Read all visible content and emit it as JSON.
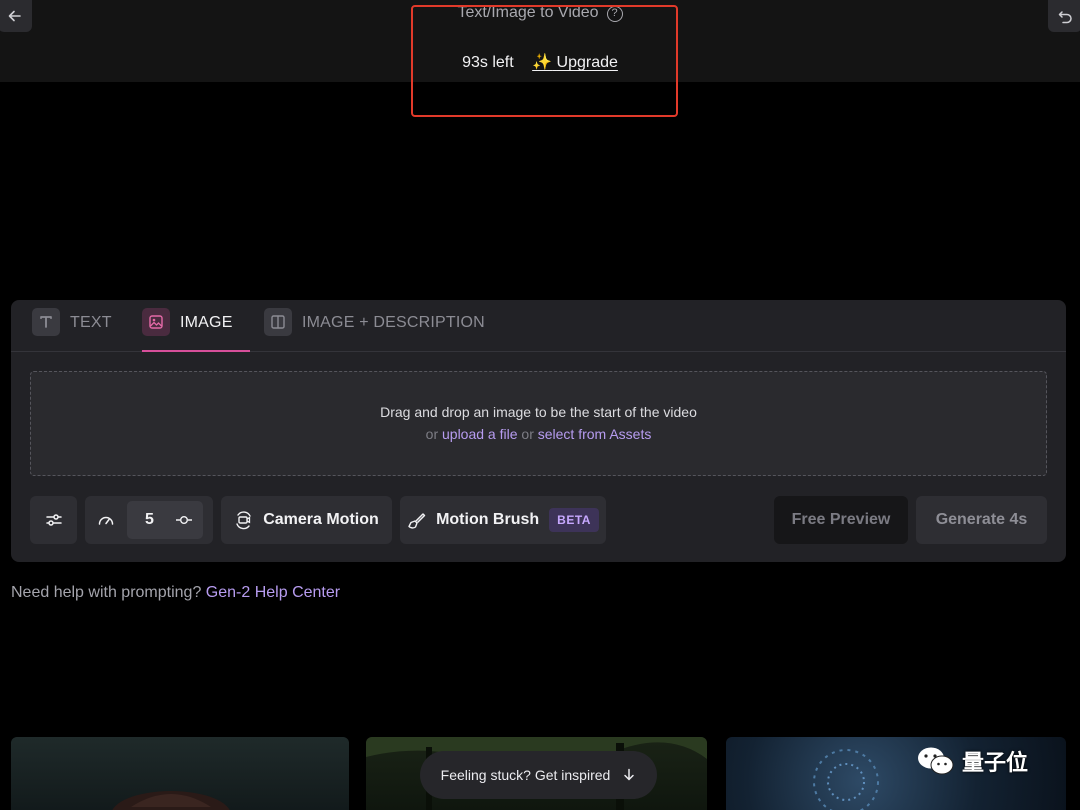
{
  "header": {
    "title": "Text/Image to Video",
    "credits_left": "93s left",
    "upgrade_label": "Upgrade",
    "upgrade_emoji": "✨"
  },
  "tabs": [
    {
      "label": "TEXT",
      "icon": "text-t-icon",
      "active": false
    },
    {
      "label": "IMAGE",
      "icon": "image-icon",
      "active": true
    },
    {
      "label": "IMAGE + DESCRIPTION",
      "icon": "split-panel-icon",
      "active": false
    }
  ],
  "dropzone": {
    "line1": "Drag and drop an image to be the start of the video",
    "or1": "or",
    "upload_link": "upload a file",
    "or2": "or",
    "assets_link": "select from Assets"
  },
  "controls": {
    "speed_value": "5",
    "camera_motion_label": "Camera Motion",
    "motion_brush_label": "Motion Brush",
    "beta_badge": "BETA",
    "free_preview_label": "Free Preview",
    "generate_label": "Generate 4s"
  },
  "help": {
    "prefix": "Need help with prompting?",
    "link": "Gen-2 Help Center"
  },
  "inspire": {
    "label": "Feeling stuck? Get inspired"
  },
  "watermark": {
    "text": "量子位"
  },
  "colors": {
    "accent_pink": "#d74f9a",
    "link_purple": "#b79cf0",
    "highlight_red": "#e23a2a"
  }
}
